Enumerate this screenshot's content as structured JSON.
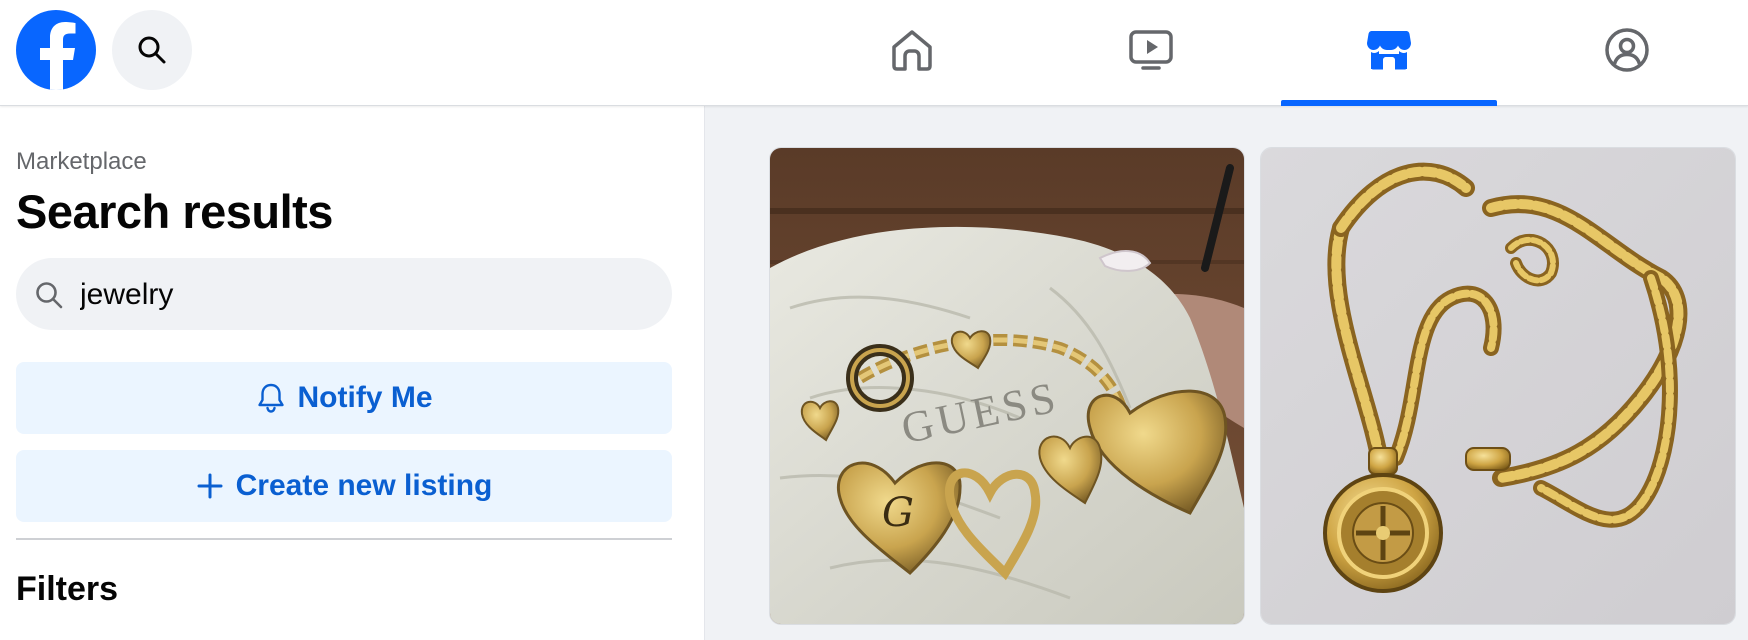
{
  "topbar": {
    "logo_icon": "facebook-logo-icon",
    "search_icon": "search-icon",
    "tabs": [
      {
        "name": "home",
        "icon": "home-icon",
        "active": false
      },
      {
        "name": "watch",
        "icon": "video-icon",
        "active": false
      },
      {
        "name": "marketplace",
        "icon": "marketplace-store-icon",
        "active": true
      },
      {
        "name": "groups",
        "icon": "groups-icon",
        "active": false
      }
    ],
    "accent_color": "#0866ff"
  },
  "sidebar": {
    "breadcrumb": "Marketplace",
    "title": "Search results",
    "search": {
      "value": "jewelry",
      "icon": "search-icon"
    },
    "notify_button": {
      "label": "Notify Me",
      "icon": "bell-icon"
    },
    "create_button": {
      "label": "Create new listing",
      "icon": "plus-icon"
    },
    "filters_title": "Filters"
  },
  "listings": [
    {
      "image": "gold-charm-bracelet-photo"
    },
    {
      "image": "gold-chain-necklace-photo"
    }
  ]
}
